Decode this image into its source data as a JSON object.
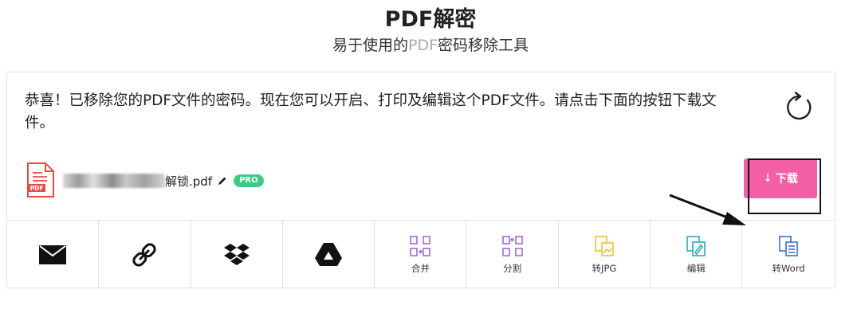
{
  "header": {
    "title": "PDF解密",
    "subtitle_prefix": "易于使用的",
    "subtitle_pdf": "PDF",
    "subtitle_suffix": "密码移除工具"
  },
  "message": "恭喜！已移除您的PDF文件的密码。现在您可以开启、打印及编辑这个PDF文件。请点击下面的按钮下载文件。",
  "file": {
    "name_visible": "解锁.pdf",
    "pro_badge": "PRO",
    "icon_label": "PDF"
  },
  "download_button": {
    "label": "下载",
    "arrow": "↓"
  },
  "tools": [
    {
      "name": "email-icon",
      "label": ""
    },
    {
      "name": "link-icon",
      "label": ""
    },
    {
      "name": "dropbox-icon",
      "label": ""
    },
    {
      "name": "google-drive-icon",
      "label": ""
    },
    {
      "name": "merge-icon",
      "label": "合并"
    },
    {
      "name": "split-icon",
      "label": "分割"
    },
    {
      "name": "to-jpg-icon",
      "label": "转JPG"
    },
    {
      "name": "edit-icon",
      "label": "编辑"
    },
    {
      "name": "to-word-icon",
      "label": "转Word"
    }
  ],
  "colors": {
    "download_button": "#f25fa5",
    "pro_badge": "#3fcb86",
    "merge_split_icons": "#a06ad6",
    "jpg_icon": "#e9c23a",
    "edit_icon": "#2fa9b4",
    "word_icon": "#3d6fd0",
    "pdf_icon": "#e84b47"
  }
}
